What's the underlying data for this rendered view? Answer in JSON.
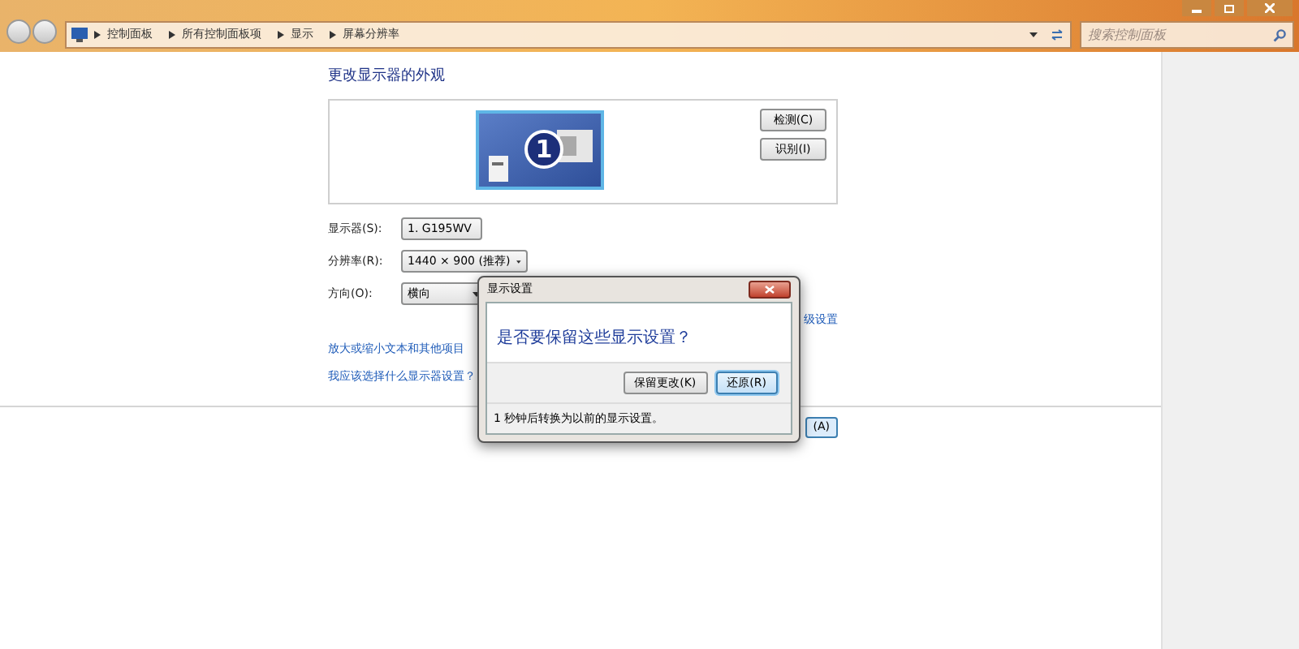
{
  "address_bar": {
    "breadcrumbs": [
      "控制面板",
      "所有控制面板项",
      "显示",
      "屏幕分辨率"
    ]
  },
  "search": {
    "placeholder": "搜索控制面板"
  },
  "heading": "更改显示器的外观",
  "preview": {
    "monitor_number": "1",
    "buttons": [
      "检测(C)",
      "识别(I)"
    ]
  },
  "settings": [
    {
      "label": "显示器(S):",
      "value": "1. G195WV"
    },
    {
      "label": "分辨率(R):",
      "value": "1440 × 900 (推荐)"
    },
    {
      "label": "方向(O):",
      "value": "横向"
    }
  ],
  "advanced_link": "级设置",
  "links": [
    "放大或缩小文本和其他项目",
    "我应该选择什么显示器设置？"
  ],
  "apply_button": "(A)",
  "dialog": {
    "title": "显示设置",
    "question": "是否要保留这些显示设置？",
    "buttons": [
      {
        "label": "保留更改(K)",
        "selected": false
      },
      {
        "label": "还原(R)",
        "selected": true
      }
    ],
    "countdown": "1 秒钟后转换为以前的显示设置。"
  }
}
